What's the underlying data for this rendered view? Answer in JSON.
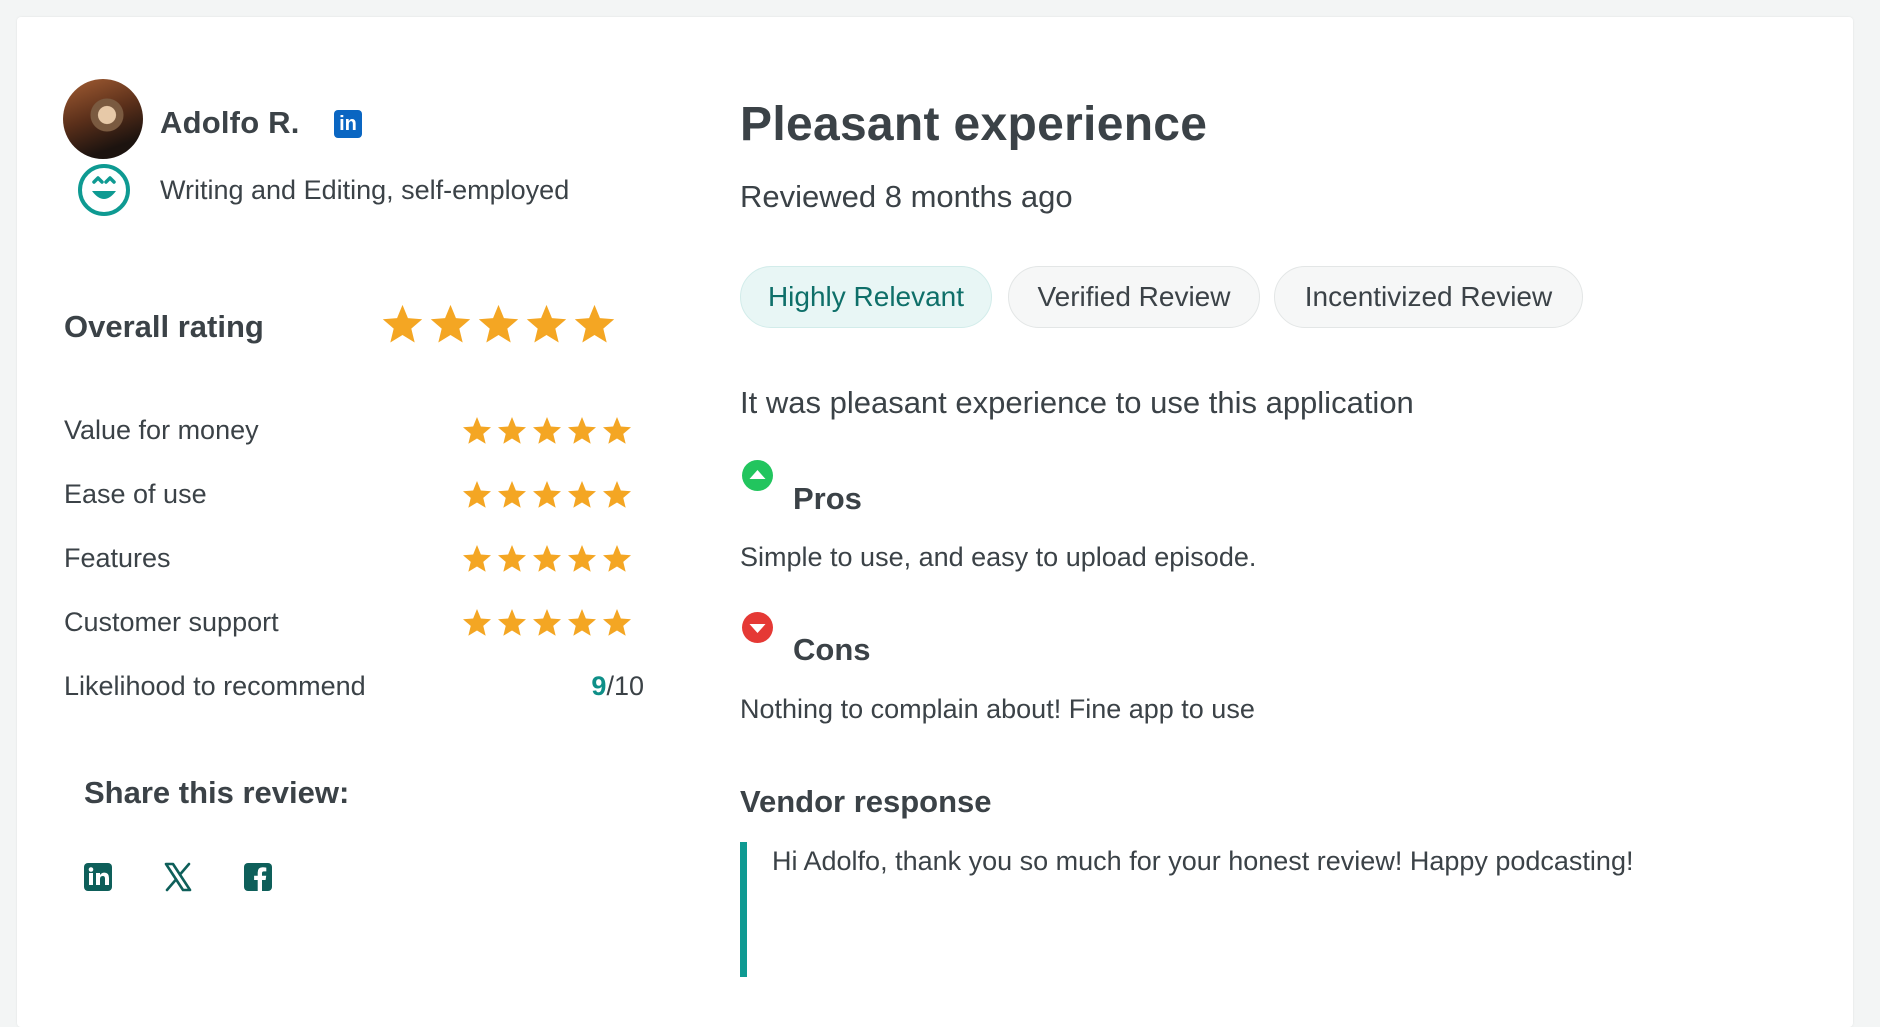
{
  "reviewer": {
    "name": "Adolfo R.",
    "linkedin_badge": "in",
    "role": "Writing and Editing, self-employed",
    "avatar_icon": "avatar-photo",
    "sentiment_icon": "smiling-face-icon"
  },
  "ratings": {
    "overall_label": "Overall rating",
    "overall_stars": 5,
    "max_stars": 5,
    "star_color": "#f4a623",
    "items": [
      {
        "label": "Value for money",
        "stars": 5
      },
      {
        "label": "Ease of use",
        "stars": 5
      },
      {
        "label": "Features",
        "stars": 5
      },
      {
        "label": "Customer support",
        "stars": 5
      }
    ],
    "recommend": {
      "label": "Likelihood to recommend",
      "score": "9",
      "out_of": "/10"
    }
  },
  "share": {
    "title": "Share this review:",
    "buttons": [
      "linkedin-icon",
      "x-icon",
      "facebook-icon"
    ],
    "icon_color": "#0e5f5a"
  },
  "review": {
    "title": "Pleasant experience",
    "date": "Reviewed 8 months ago",
    "tags": [
      "Highly Relevant",
      "Verified Review",
      "Incentivized Review"
    ],
    "summary": "It was pleasant experience to use this application",
    "pros": {
      "title": "Pros",
      "text": "Simple to use, and easy to upload episode.",
      "color": "#22c55e"
    },
    "cons": {
      "title": "Cons",
      "text": "Nothing to complain about! Fine app to use",
      "color": "#e53935"
    },
    "vendor": {
      "title": "Vendor response",
      "text": "Hi Adolfo, thank you so much for your honest review! Happy podcasting!"
    }
  },
  "colors": {
    "accent": "#0e9a92",
    "text": "#3b4247",
    "linkedin": "#0a66c2"
  }
}
